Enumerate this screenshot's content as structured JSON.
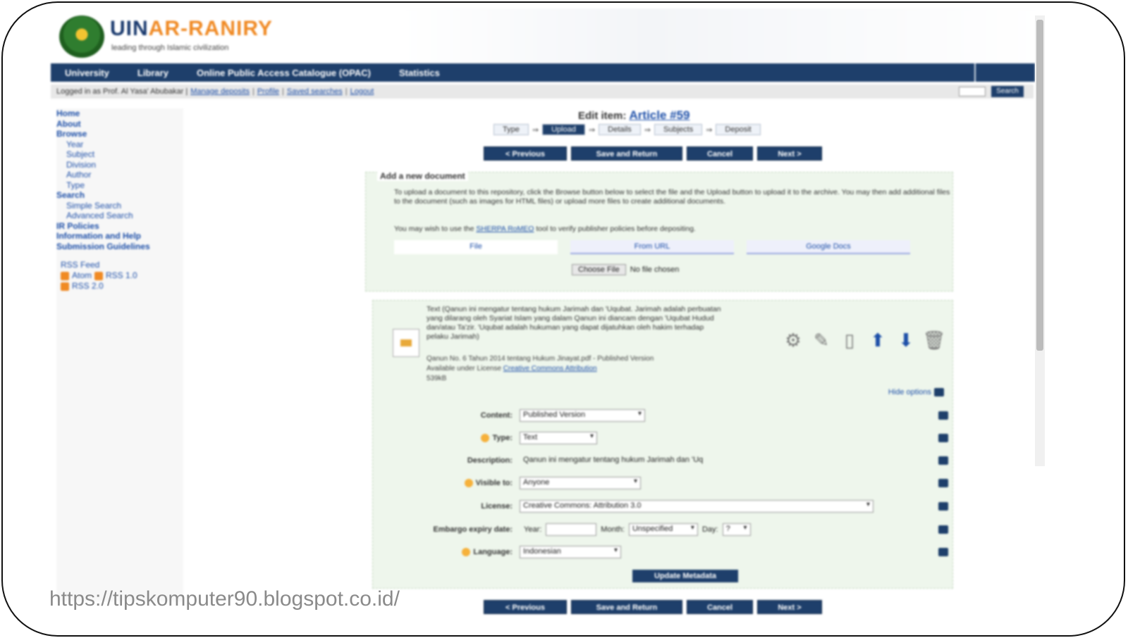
{
  "header": {
    "logo_uin": "UIN",
    "logo_name": "AR-RANIRY",
    "tagline": "leading through Islamic civilization"
  },
  "nav": {
    "items": [
      "University",
      "Library",
      "Online Public Access Catalogue (OPAC)",
      "Statistics"
    ]
  },
  "login": {
    "text": "Logged in as Prof. Al Yasa' Abubakar |",
    "links": [
      "Manage deposits",
      "Profile",
      "Saved searches",
      "Logout"
    ],
    "search_button": "Search"
  },
  "sidebar": {
    "top": [
      "Home",
      "About",
      "Browse"
    ],
    "browse_sub": [
      "Year",
      "Subject",
      "Division",
      "Author",
      "Type"
    ],
    "search": "Search",
    "search_sub": [
      "Simple Search",
      "Advanced Search"
    ],
    "bottom": [
      "IR Policies",
      "Information and Help",
      "Submission Guidelines"
    ],
    "rss_title": "RSS Feed",
    "rss": [
      "Atom",
      "RSS 1.0",
      "RSS 2.0"
    ]
  },
  "main": {
    "edit_label": "Edit item:",
    "article": "Article #59",
    "steps": [
      "Type",
      "Upload",
      "Details",
      "Subjects",
      "Deposit"
    ],
    "buttons": {
      "previous": "< Previous",
      "save": "Save and Return",
      "cancel": "Cancel",
      "next": "Next >"
    }
  },
  "upload_panel": {
    "title": "Add a new document",
    "instructions": "To upload a document to this repository, click the Browse button below to select the file and the Upload button to upload it to the archive. You may then add additional files to the document (such as images for HTML files) or upload more files to create additional documents.",
    "sherpa_pre": "You may wish to use the",
    "sherpa_link": "SHERPA RoMEO",
    "sherpa_post": "tool to verify publisher policies before depositing.",
    "tabs": [
      "File",
      "From URL",
      "Google Docs"
    ],
    "choose_file": "Choose File",
    "no_file": "No file chosen"
  },
  "document": {
    "description": "Text (Qanun ini mengatur tentang hukum Jarimah dan 'Uqubat. Jarimah adalah perbuatan yang dilarang oleh Syariat Islam yang dalam Qanun ini diancam dengan 'Uqubat Hudud dan/atau Ta'zir. 'Uqubat adalah hukuman yang dapat dijatuhkan oleh hakim terhadap pelaku Jarimah)",
    "filename": "Qanun No. 6 Tahun 2014 tentang Hukum Jinayat.pdf - Published Version",
    "license_pre": "Available under License",
    "license_link": "Creative Commons Attribution",
    "size": "539kB",
    "hide_options": "Hide options"
  },
  "metadata": {
    "content_label": "Content:",
    "content_value": "Published Version",
    "type_label": "Type:",
    "type_value": "Text",
    "description_label": "Description:",
    "description_value": "Qanun ini mengatur tentang hukum Jarimah dan 'Uq",
    "visible_label": "Visible to:",
    "visible_value": "Anyone",
    "license_label": "License:",
    "license_value": "Creative Commons: Attribution 3.0",
    "embargo_label": "Embargo expiry date:",
    "year_label": "Year:",
    "month_label": "Month:",
    "month_value": "Unspecified",
    "day_label": "Day:",
    "day_value": "?",
    "language_label": "Language:",
    "language_value": "Indonesian",
    "update_button": "Update Metadata"
  },
  "watermark": "https://tipskomputer90.blogspot.co.id/"
}
